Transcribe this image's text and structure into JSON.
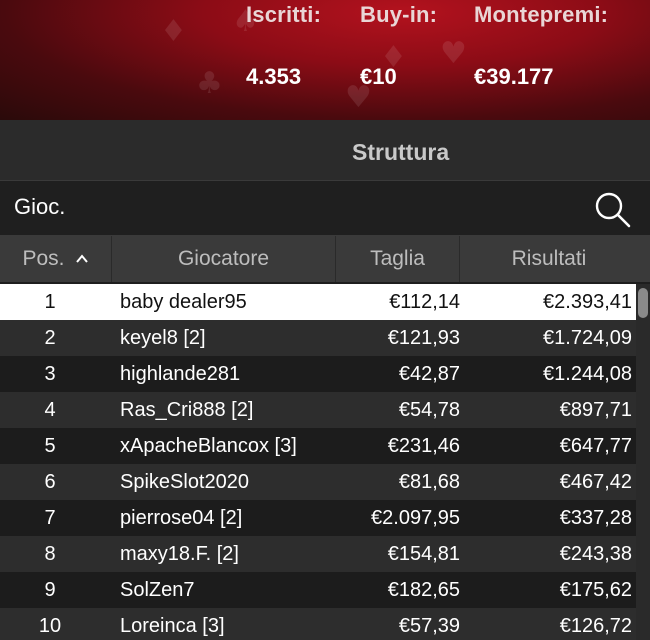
{
  "tournament": {
    "entrants_label": "Iscritti:",
    "entrants_value": "4.353",
    "buyin_label": "Buy-in:",
    "buyin_value": "€10",
    "prizepool_label": "Montepremi:",
    "prizepool_value": "€39.177"
  },
  "section_title": "Struttura",
  "search": {
    "value": "Gioc.",
    "icon": "magnifier-icon"
  },
  "table": {
    "columns": [
      "Pos.",
      "Giocatore",
      "Taglia",
      "Risultati"
    ],
    "sort": {
      "column": "Pos.",
      "direction": "ascending"
    },
    "rows": [
      {
        "pos": "1",
        "player": "baby dealer95",
        "bounty": "€112,14",
        "result": "€2.393,41"
      },
      {
        "pos": "2",
        "player": "keyel8 [2]",
        "bounty": "€121,93",
        "result": "€1.724,09"
      },
      {
        "pos": "3",
        "player": "highlande281",
        "bounty": "€42,87",
        "result": "€1.244,08"
      },
      {
        "pos": "4",
        "player": "Ras_Cri888 [2]",
        "bounty": "€54,78",
        "result": "€897,71"
      },
      {
        "pos": "5",
        "player": "xApacheBlancox [3]",
        "bounty": "€231,46",
        "result": "€647,77"
      },
      {
        "pos": "6",
        "player": "SpikeSlot2020",
        "bounty": "€81,68",
        "result": "€467,42"
      },
      {
        "pos": "7",
        "player": "pierrose04 [2]",
        "bounty": "€2.097,95",
        "result": "€337,28"
      },
      {
        "pos": "8",
        "player": "maxy18.F. [2]",
        "bounty": "€154,81",
        "result": "€243,38"
      },
      {
        "pos": "9",
        "player": "SolZen7",
        "bounty": "€182,65",
        "result": "€175,62"
      },
      {
        "pos": "10",
        "player": "Loreinca [3]",
        "bounty": "€57,39",
        "result": "€126,72"
      }
    ],
    "selected_row": 0
  },
  "colors": {
    "banner_red": "#b3121e",
    "header_gray": "#3a3a3a",
    "row_odd": "#2d2d2d",
    "row_even": "#1c1c1c",
    "selected_row": "#ffffff"
  }
}
